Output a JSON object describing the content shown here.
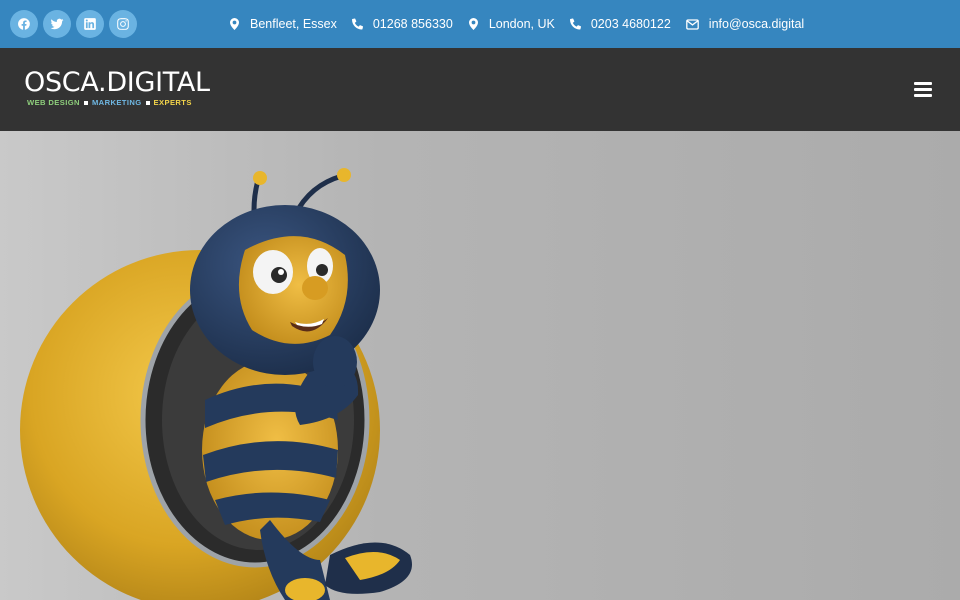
{
  "social": [
    {
      "name": "facebook",
      "icon": "facebook-icon"
    },
    {
      "name": "twitter",
      "icon": "twitter-icon"
    },
    {
      "name": "linkedin",
      "icon": "linkedin-icon"
    },
    {
      "name": "instagram",
      "icon": "instagram-icon"
    }
  ],
  "contacts": {
    "location1": "Benfleet, Essex",
    "phone1": "01268 856330",
    "location2": "London, UK",
    "phone2": "0203 4680122",
    "email": "info@osca.digital"
  },
  "logo": {
    "main": "OSCA.DIGITAL",
    "tag1": "WEB DESIGN",
    "tag2": "MARKETING",
    "tag3": "EXPERTS"
  },
  "colors": {
    "topbar": "#3686bf",
    "header": "#333333",
    "bee_yellow": "#e8b62c",
    "bee_navy": "#243a5c"
  },
  "hero": {
    "image": "bee-mascot-in-pod"
  }
}
